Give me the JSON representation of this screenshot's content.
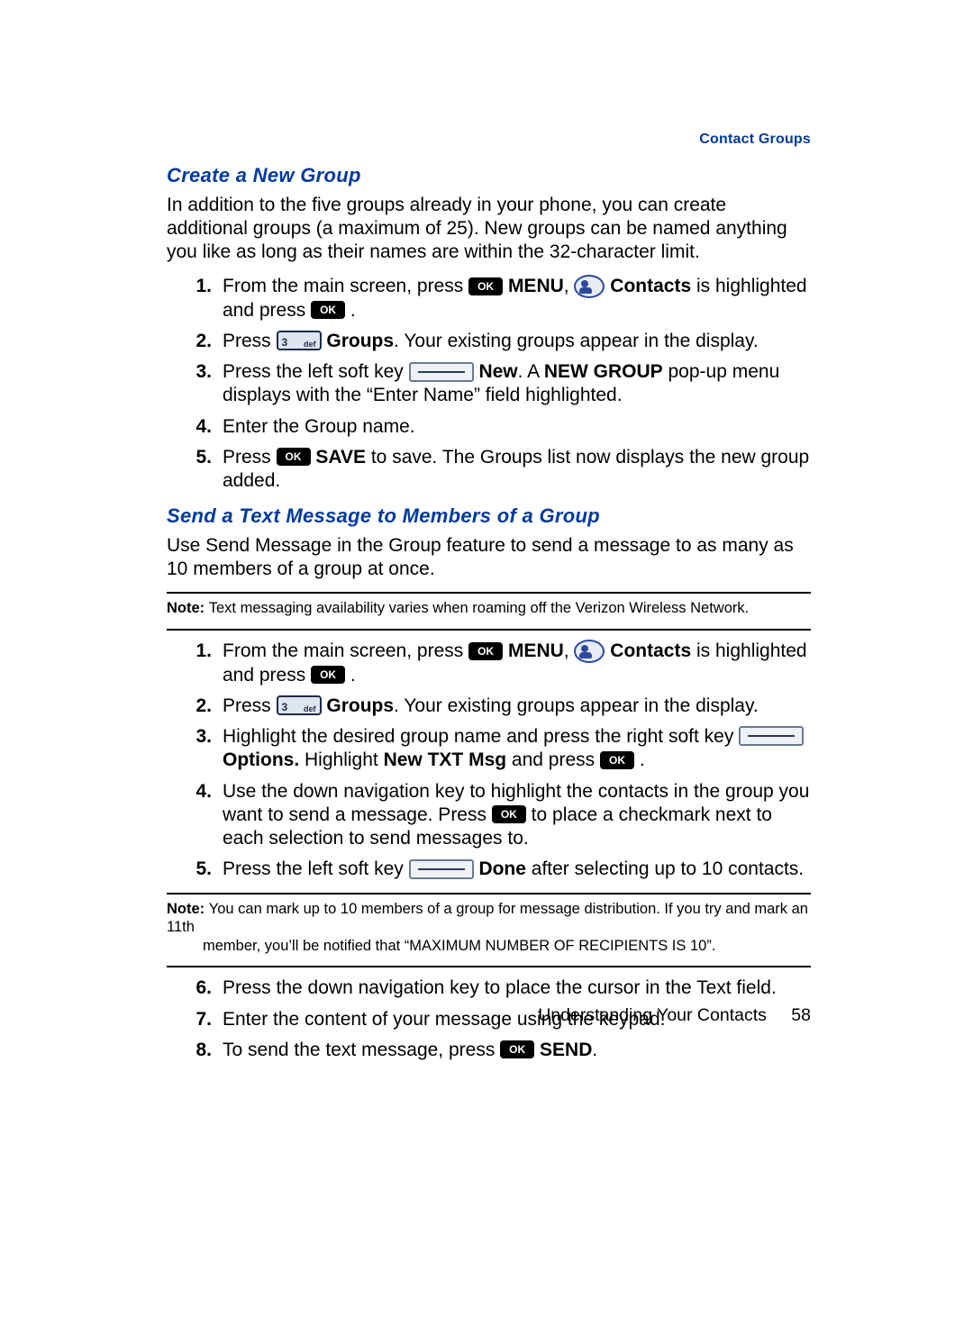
{
  "header": {
    "section_label": "Contact Groups"
  },
  "sections": {
    "create": {
      "heading": "Create a New Group",
      "intro": "In addition to the five groups already in your phone, you can create additional groups (a maximum of 25). New groups can be named anything you like as long as their names are within the 32-character limit.",
      "steps": {
        "s1": {
          "n": "1.",
          "t1": "From the main screen, press ",
          "menu": "MENU",
          "comma": ", ",
          "contacts": "Contacts",
          "t2": " is highlighted and press ",
          "dot": "."
        },
        "s2": {
          "n": "2.",
          "t1": "Press ",
          "groups": "Groups",
          "t2": ". Your existing groups appear in the display."
        },
        "s3": {
          "n": "3.",
          "t1": "Press the left soft key ",
          "new": "New",
          "t2": ". A ",
          "newgroup": "NEW GROUP",
          "t3": " pop-up menu displays with the “Enter Name” field highlighted."
        },
        "s4": {
          "n": "4.",
          "t1": "Enter the Group name."
        },
        "s5": {
          "n": "5.",
          "t1": "Press ",
          "save": "SAVE",
          "t2": " to save. The Groups list now displays the new group added."
        }
      }
    },
    "send": {
      "heading": "Send a Text Message to Members of a Group",
      "intro": "Use Send Message in the Group feature to send a message to as many as 10 members of a group at once.",
      "note1": {
        "label": "Note: ",
        "body": "Text messaging availability varies when roaming off the Verizon Wireless Network."
      },
      "steps": {
        "s1": {
          "n": "1.",
          "t1": "From the main screen, press ",
          "menu": "MENU",
          "comma": ", ",
          "contacts": "Contacts",
          "t2": " is highlighted and press ",
          "dot": "."
        },
        "s2": {
          "n": "2.",
          "t1": "Press ",
          "groups": "Groups",
          "t2": ". Your existing groups appear in the display."
        },
        "s3": {
          "n": "3.",
          "t1": "Highlight the desired group name and press the right soft key ",
          "options": "Options.",
          "t2": " Highlight ",
          "newtxt": "New TXT Msg",
          "t3": " and press ",
          "dot": "."
        },
        "s4": {
          "n": "4.",
          "t1": "Use the down navigation key to highlight the contacts in the group you want to send a message. Press ",
          "t2": " to place a checkmark next to each selection to send messages to."
        },
        "s5": {
          "n": "5.",
          "t1": "Press the left soft key ",
          "done": "Done",
          "t2": " after selecting up to 10 contacts."
        }
      },
      "note2": {
        "label": "Note: ",
        "line1": "You can mark up to 10 members of a group for message distribution. If you try and mark an 11th",
        "line2": "member, you’ll be notified that “MAXIMUM NUMBER OF RECIPIENTS IS 10”."
      },
      "steps2": {
        "s6": {
          "n": "6.",
          "t1": "Press the down navigation key to place the cursor in the Text field."
        },
        "s7": {
          "n": "7.",
          "t1": "Enter the content of your message using the keypad."
        },
        "s8": {
          "n": "8.",
          "t1": "To send the text message, press ",
          "send": "SEND",
          "dot": "."
        }
      }
    }
  },
  "footer": {
    "chapter": "Understanding Your Contacts",
    "page": "58"
  },
  "icons": {
    "ok": "OK"
  }
}
